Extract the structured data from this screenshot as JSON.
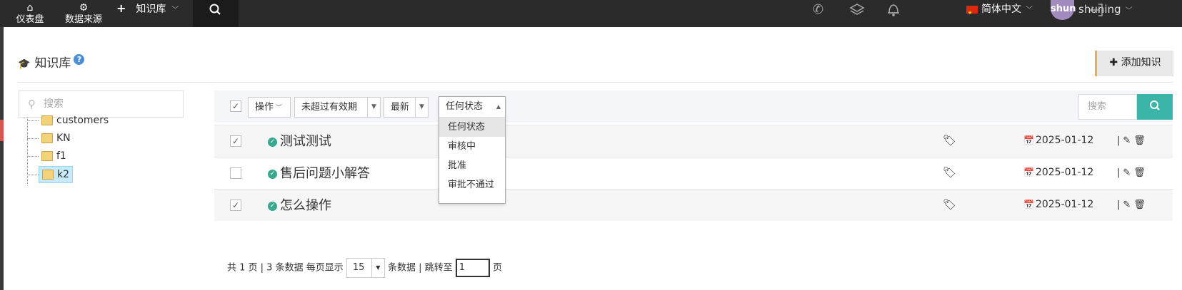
{
  "nav": {
    "dashboard": "仪表盘",
    "datasource": "数据来源",
    "knowledge": "知识库",
    "language": "简体中文",
    "avatar_text": "shun",
    "username": "shuning"
  },
  "page": {
    "title": "知识库",
    "help": "?",
    "add_button": "添加知识"
  },
  "tree": {
    "search_placeholder": "搜索",
    "items": [
      {
        "label": "customers"
      },
      {
        "label": "KN"
      },
      {
        "label": "f1"
      },
      {
        "label": "k2",
        "selected": true
      }
    ]
  },
  "toolbar": {
    "action": "操作",
    "validity": "未超过有效期",
    "sort": "最新",
    "status": "任何状态",
    "status_options": [
      "任何状态",
      "审核中",
      "批准",
      "审批不通过"
    ],
    "search_placeholder": "搜索"
  },
  "rows": [
    {
      "title": "测试测试",
      "date": "2025-01-12",
      "checked": true
    },
    {
      "title": "售后问题小解答",
      "date": "2025-01-12",
      "checked": false
    },
    {
      "title": "怎么操作",
      "date": "2025-01-12",
      "checked": true
    }
  ],
  "pager": {
    "pages_text": "共 1 页 | 3 条数据 每页显示",
    "per_page": "15",
    "records_text": "条数据 | 跳转至",
    "jump_value": "1",
    "page_unit": "页"
  },
  "colors": {
    "accent": "#3bb5a7",
    "topbar": "#2b2b2b",
    "add_border": "#f0ad4e"
  }
}
